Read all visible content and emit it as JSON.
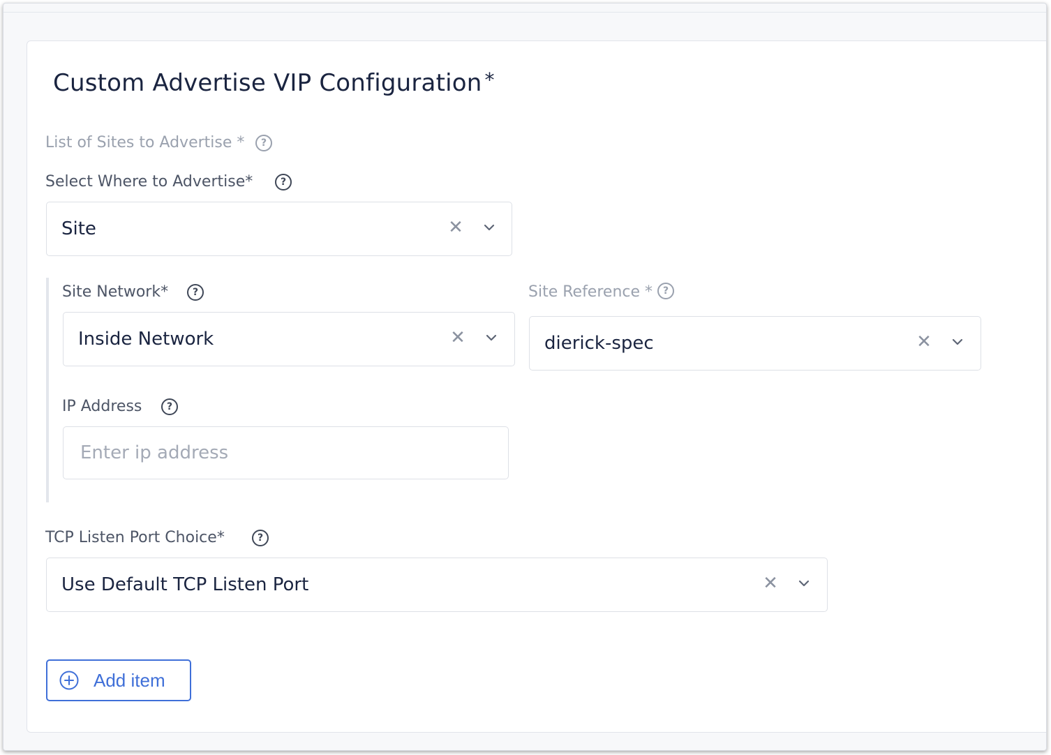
{
  "section": {
    "title": "Custom Advertise VIP Configuration",
    "required_mark": "*"
  },
  "sites_list": {
    "label": "List of Sites to Advertise *"
  },
  "where": {
    "label": "Select Where to Advertise*",
    "value": "Site"
  },
  "site_network": {
    "label": "Site Network*",
    "value": "Inside Network"
  },
  "site_reference": {
    "label": "Site Reference *",
    "value": "dierick-spec"
  },
  "ip_address": {
    "label": "IP Address",
    "placeholder": "Enter ip address",
    "value": ""
  },
  "tcp_port": {
    "label": "TCP Listen Port Choice*",
    "value": "Use Default TCP Listen Port"
  },
  "add_button": {
    "label": "Add item"
  },
  "icons": {
    "help": "question-circle-icon",
    "clear": "close-icon",
    "dropdown": "chevron-down-icon",
    "add": "plus-circle-icon"
  },
  "colors": {
    "accent": "#3f6fd8",
    "title": "#1a2440",
    "label": "#4d5566",
    "muted_label": "#9aa1ae"
  }
}
